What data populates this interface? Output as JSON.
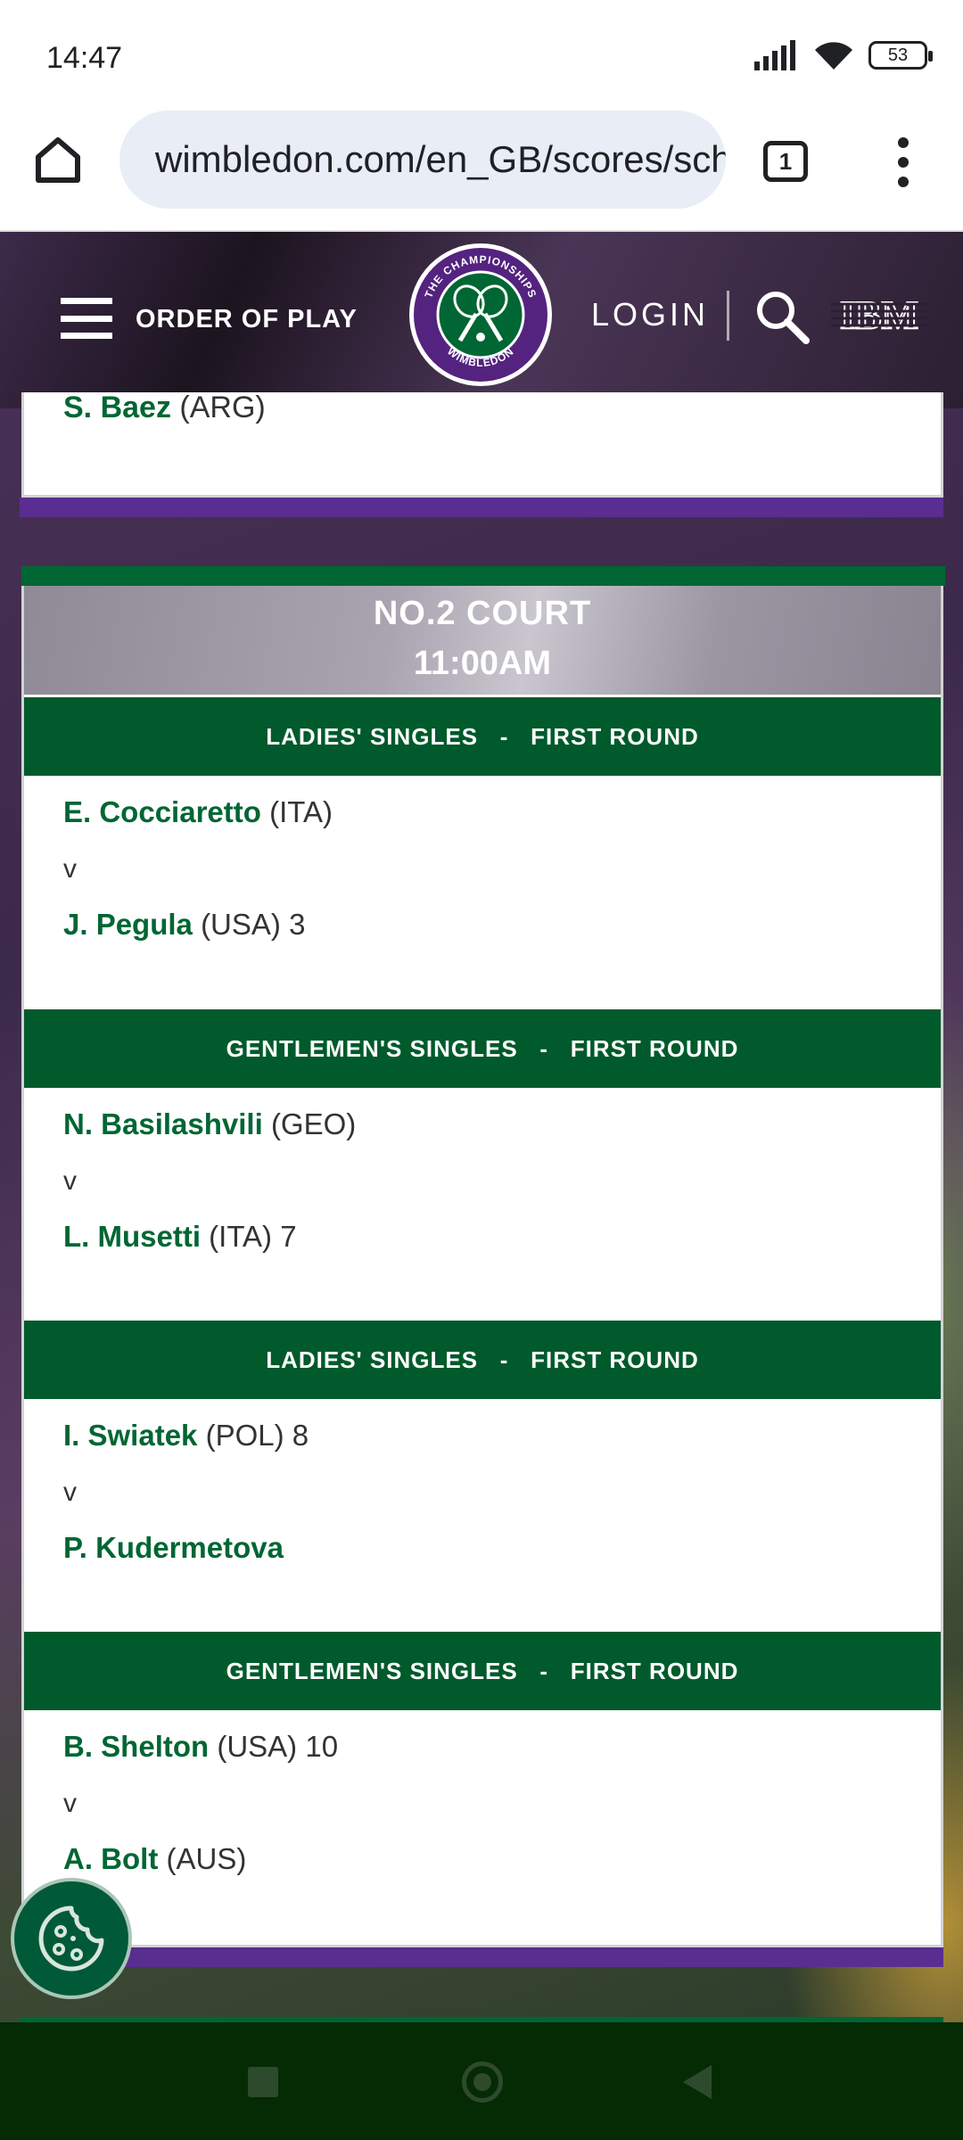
{
  "status_bar": {
    "time": "14:47",
    "battery": "53"
  },
  "browser": {
    "url": "wimbledon.com/en_GB/scores/schedule/",
    "tab_count": "1"
  },
  "header": {
    "menu_label": "ORDER OF PLAY",
    "login_label": "LOGIN",
    "logo_text": "THE CHAMPIONSHIPS WIMBLEDON",
    "sponsor": "IBM"
  },
  "previous_court": {
    "last_player": {
      "name": "S. Baez",
      "country": "(ARG)",
      "seed": ""
    }
  },
  "court": {
    "name": "NO.2 COURT",
    "time": "11:00AM",
    "matches": [
      {
        "event": "LADIES' SINGLES   -   FIRST ROUND",
        "p1": {
          "name": "E. Cocciaretto",
          "info": "(ITA)"
        },
        "vs": "v",
        "p2": {
          "name": "J. Pegula",
          "info": "(USA) 3"
        }
      },
      {
        "event": "GENTLEMEN'S SINGLES   -   FIRST ROUND",
        "p1": {
          "name": "N. Basilashvili",
          "info": "(GEO)"
        },
        "vs": "v",
        "p2": {
          "name": "L. Musetti",
          "info": "(ITA) 7"
        }
      },
      {
        "event": "LADIES' SINGLES   -   FIRST ROUND",
        "p1": {
          "name": "I. Swiatek",
          "info": "(POL) 8"
        },
        "vs": "v",
        "p2": {
          "name": "P. Kudermetova",
          "info": ""
        }
      },
      {
        "event": "GENTLEMEN'S SINGLES   -   FIRST ROUND",
        "p1": {
          "name": "B. Shelton",
          "info": "(USA) 10"
        },
        "vs": "v",
        "p2": {
          "name": "A. Bolt",
          "info": "(AUS)"
        }
      }
    ]
  },
  "icons": {
    "home": "home-icon",
    "site_settings": "tune-icon",
    "menu": "more-vert-icon",
    "hamburger": "hamburger-icon",
    "search": "search-icon",
    "cookie": "cookie-icon"
  },
  "colors": {
    "brand_green": "#006633",
    "header_green": "#005a2b",
    "brand_purple": "#5a2d91"
  }
}
